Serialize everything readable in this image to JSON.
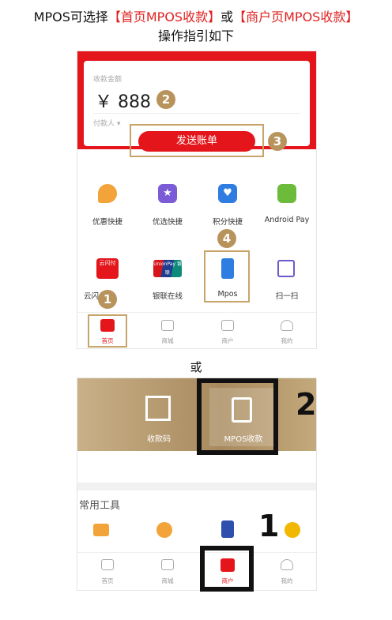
{
  "header": {
    "line1_prefix": "MPOS可选择",
    "line1_opt1": "【首页MPOS收款】",
    "line1_mid": "或",
    "line1_opt2": "【商户页MPOS收款】",
    "line2": "操作指引如下"
  },
  "colors": {
    "accent_red": "#e4151b",
    "badge_gold": "#b8935c",
    "highlight_box": "#c8a46a",
    "bold_box": "#111111"
  },
  "home_screen": {
    "amount_label": "收款金额",
    "currency": "￥",
    "amount": "888",
    "payer_label": "付款人 ▾",
    "send_button": "发送账单",
    "badges": {
      "amount": "2",
      "send": "3",
      "mpos": "4",
      "home": "1"
    },
    "grid_row1": [
      {
        "label": "优惠快捷",
        "icon": "coupon-icon"
      },
      {
        "label": "优选快捷",
        "icon": "star-icon"
      },
      {
        "label": "积分快捷",
        "icon": "heart-icon"
      },
      {
        "label": "Android Pay",
        "icon": "android-icon"
      }
    ],
    "grid_row2": [
      {
        "label": "云闪付",
        "icon": "cloud-pay-icon",
        "logo_text": "云闪付"
      },
      {
        "label": "银联在线",
        "icon": "unionpay-icon",
        "logo_text": "UnionPay 银联"
      },
      {
        "label": "Mpos",
        "icon": "mpos-icon"
      },
      {
        "label": "扫一扫",
        "icon": "scan-icon"
      }
    ],
    "nav": [
      {
        "label": "首页",
        "icon": "home-icon"
      },
      {
        "label": "商城",
        "icon": "shop-icon"
      },
      {
        "label": "商户",
        "icon": "merchant-icon"
      },
      {
        "label": "我的",
        "icon": "user-icon"
      }
    ]
  },
  "or_label": "或",
  "merchant_screen": {
    "tile1": "收款码",
    "tile2": "MPOS收款",
    "section_title": "常用工具",
    "big_numbers": {
      "tile": "2",
      "nav": "1"
    },
    "nav": [
      {
        "label": "首页",
        "icon": "home-icon"
      },
      {
        "label": "商城",
        "icon": "shop-icon"
      },
      {
        "label": "商户",
        "icon": "merchant-icon"
      },
      {
        "label": "我的",
        "icon": "user-icon"
      }
    ]
  }
}
